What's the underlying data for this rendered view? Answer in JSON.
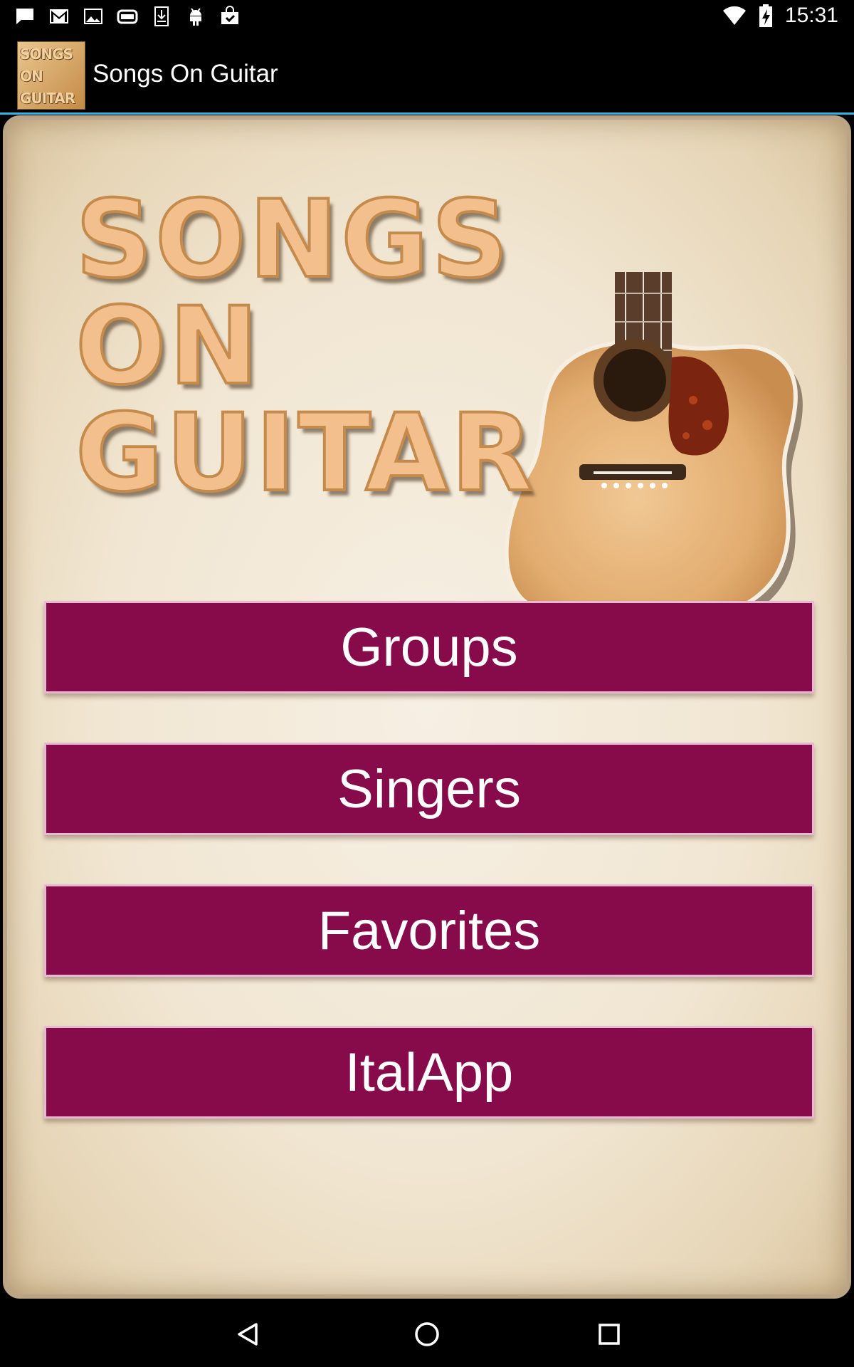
{
  "status_bar": {
    "time": "15:31",
    "left_icons": [
      "message-icon",
      "gmail-icon",
      "image-icon",
      "storage-icon",
      "download-icon",
      "android-icon",
      "store-icon"
    ],
    "right_icons": [
      "wifi-icon",
      "battery-icon"
    ]
  },
  "app_bar": {
    "title": "Songs On Guitar",
    "logo_text_lines": [
      "SONGS",
      "ON",
      "GUITAR"
    ]
  },
  "hero": {
    "title_lines": [
      "SONGS",
      "ON",
      "GUITAR"
    ]
  },
  "menu": {
    "buttons": [
      {
        "label": "Groups"
      },
      {
        "label": "Singers"
      },
      {
        "label": "Favorites"
      },
      {
        "label": "ItalApp"
      }
    ]
  },
  "colors": {
    "button_bg": "#870a4b",
    "button_border": "#e8b7d2",
    "accent_line": "#33b5e5",
    "title_fill": "#f3c08d"
  },
  "nav_bar": {
    "icons": [
      "back-icon",
      "home-icon",
      "recents-icon"
    ]
  }
}
